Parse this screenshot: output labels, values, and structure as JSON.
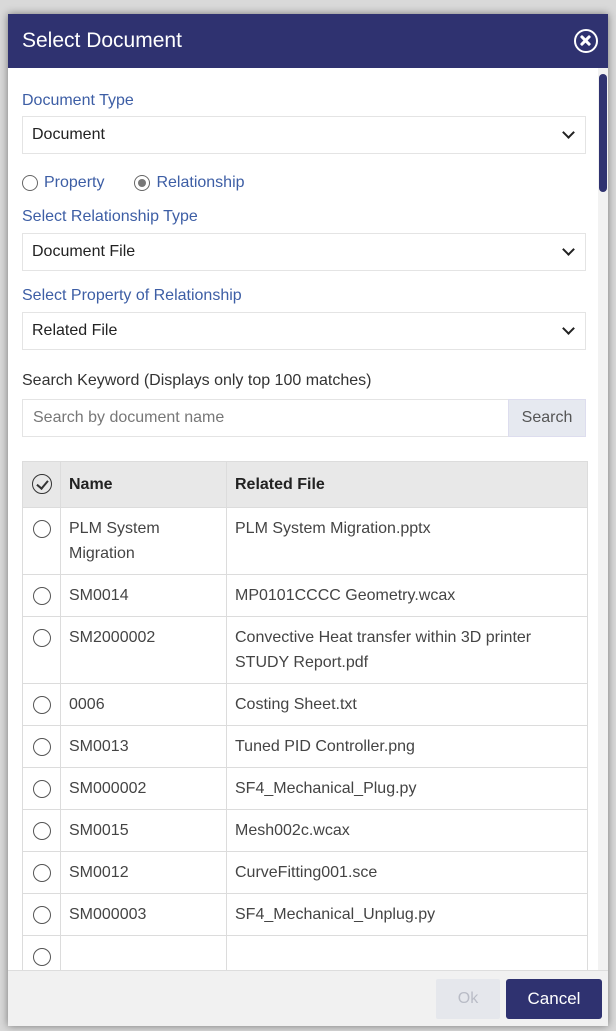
{
  "dialog": {
    "title": "Select Document",
    "close_icon": "close-circle-icon"
  },
  "document_type": {
    "label": "Document Type",
    "value": "Document"
  },
  "mode": {
    "property_label": "Property",
    "relationship_label": "Relationship",
    "selected": "Relationship"
  },
  "relationship_type": {
    "label": "Select Relationship Type",
    "value": "Document File"
  },
  "relationship_property": {
    "label": "Select Property of Relationship",
    "value": "Related File"
  },
  "search": {
    "label": "Search Keyword (Displays only top 100 matches)",
    "placeholder": "Search by document name",
    "button": "Search"
  },
  "table": {
    "headers": {
      "name": "Name",
      "related_file": "Related File"
    },
    "rows": [
      {
        "name": "PLM System Migration",
        "file": "PLM System Migration.pptx"
      },
      {
        "name": "SM0014",
        "file": "MP0101CCCC Geometry.wcax"
      },
      {
        "name": "SM2000002",
        "file": "Convective Heat transfer within 3D printer STUDY Report.pdf"
      },
      {
        "name": "0006",
        "file": "Costing Sheet.txt"
      },
      {
        "name": "SM0013",
        "file": "Tuned PID Controller.png"
      },
      {
        "name": "SM000002",
        "file": "SF4_Mechanical_Plug.py"
      },
      {
        "name": "SM0015",
        "file": "Mesh002c.wcax"
      },
      {
        "name": "SM0012",
        "file": "CurveFitting001.sce"
      },
      {
        "name": "SM000003",
        "file": "SF4_Mechanical_Unplug.py"
      },
      {
        "name": "",
        "file": ""
      }
    ]
  },
  "footer": {
    "ok": "Ok",
    "cancel": "Cancel"
  },
  "colors": {
    "header": "#2f3270",
    "label": "#3d5ea5",
    "ok_disabled": "#e5e7ec"
  }
}
